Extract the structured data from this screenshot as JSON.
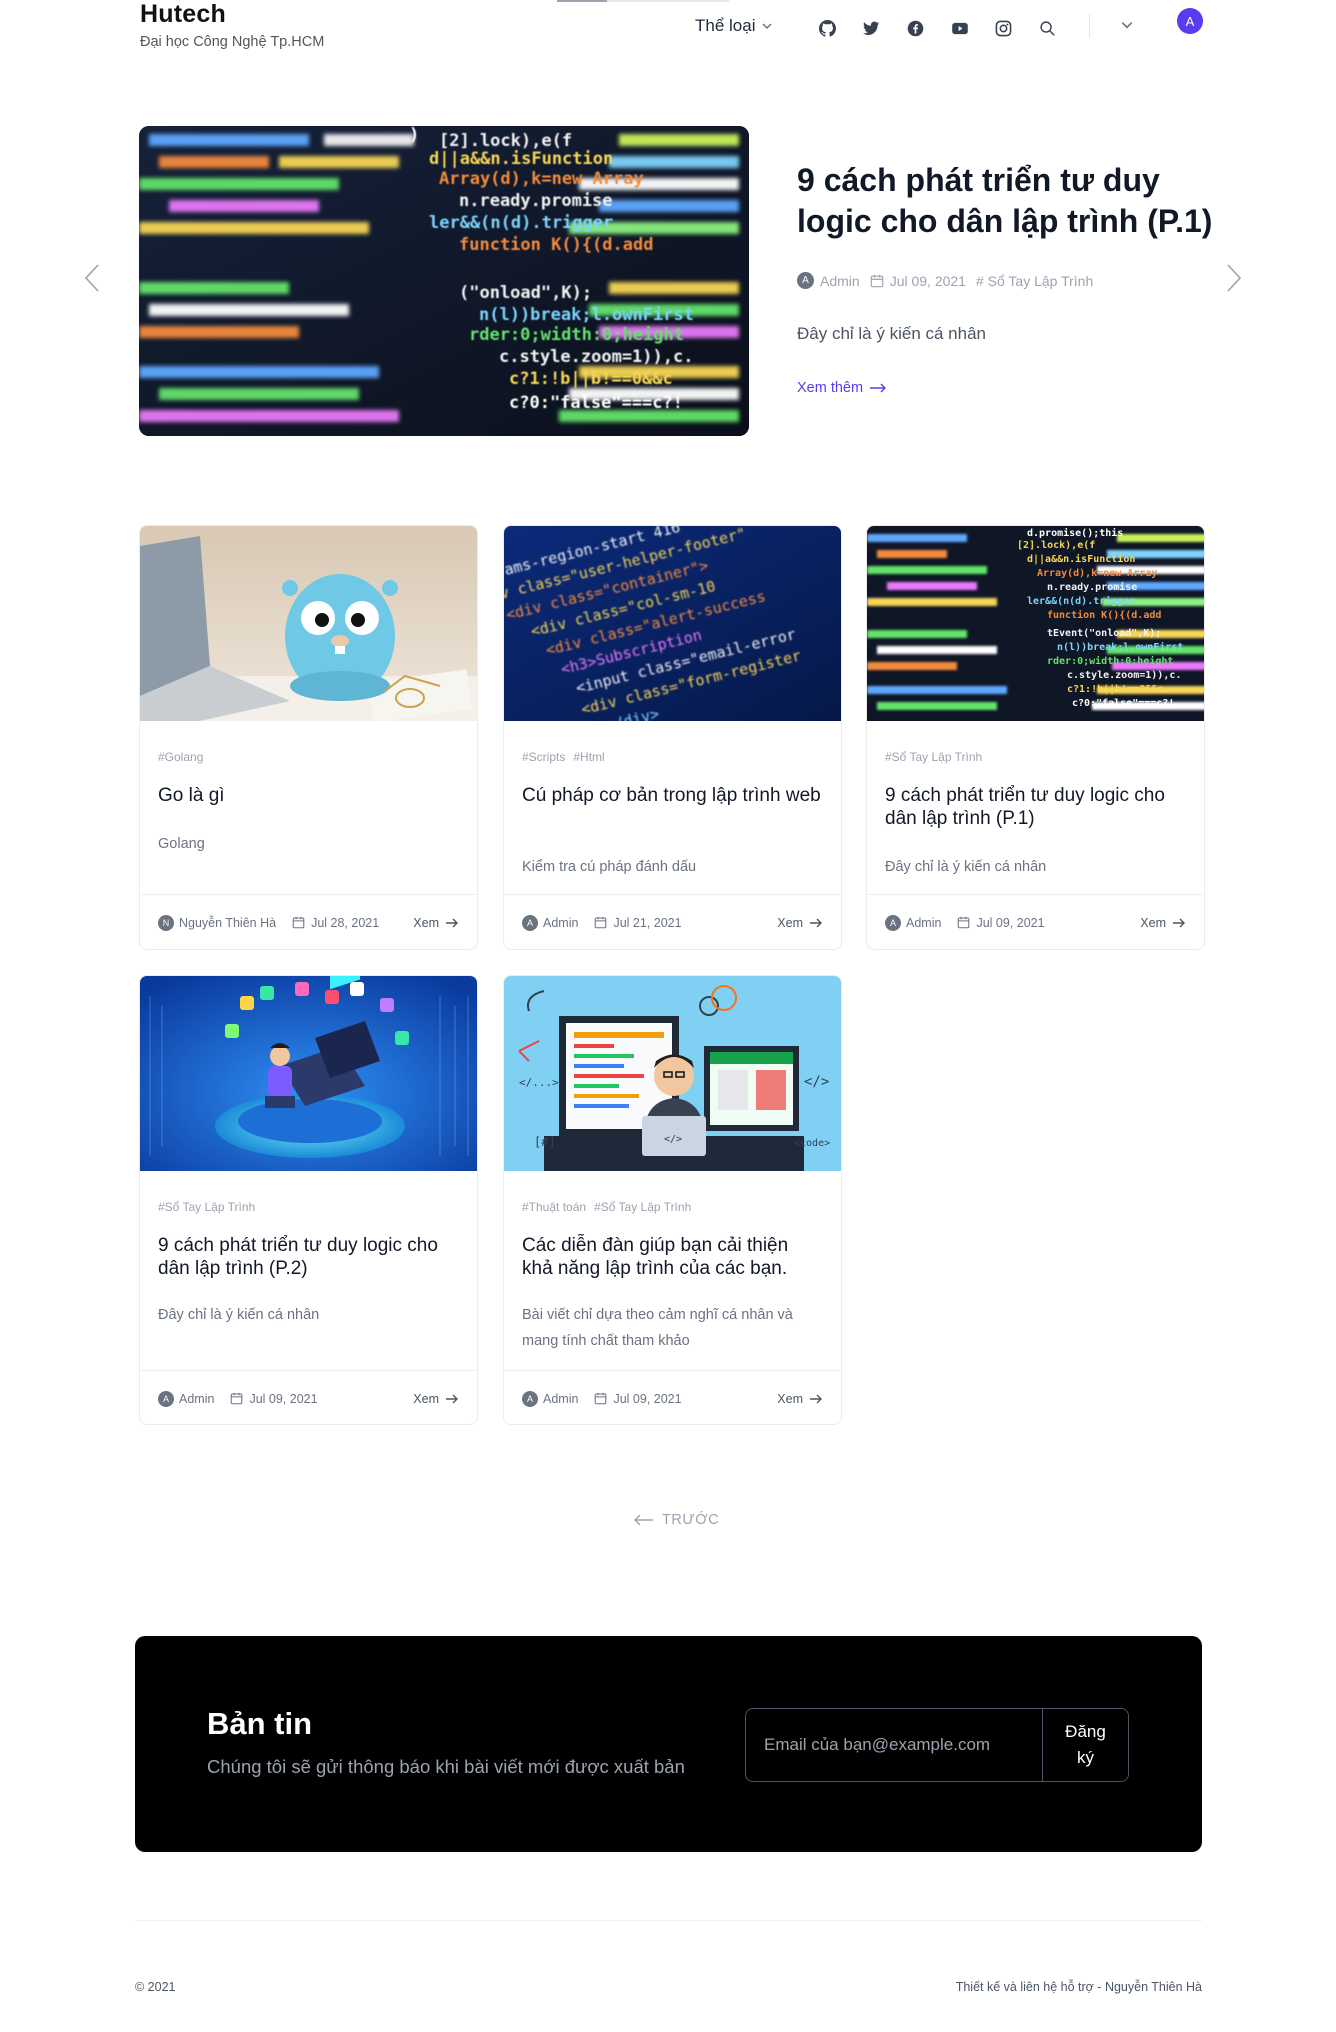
{
  "brand": {
    "title": "Hutech",
    "subtitle": "Đại học Công Nghệ Tp.HCM"
  },
  "nav": {
    "category_label": "Thể loại",
    "icons": [
      "github-icon",
      "twitter-icon",
      "facebook-icon",
      "youtube-icon",
      "instagram-icon",
      "search-icon"
    ],
    "avatar_letter": "A"
  },
  "hero": {
    "title": "9 cách phát triển tư duy logic cho dân lập trình (P.1)",
    "author_initial": "A",
    "author": "Admin",
    "date": "Jul 09, 2021",
    "tag": "# Sổ Tay Lập Trình",
    "description": "Đây chỉ là ý kiến cá nhân",
    "read_more": "Xem thêm"
  },
  "cards": [
    {
      "tags": [
        "#Golang"
      ],
      "title": "Go là gì",
      "description": "Golang",
      "author_initial": "N",
      "author": "Nguyễn Thiên Hà",
      "date": "Jul 28, 2021",
      "read": "Xem"
    },
    {
      "tags": [
        "#Scripts",
        "#Html"
      ],
      "title": "Cú pháp cơ bản trong lập trình web",
      "description": "Kiểm tra cú pháp đánh dấu",
      "author_initial": "A",
      "author": "Admin",
      "date": "Jul 21, 2021",
      "read": "Xem"
    },
    {
      "tags": [
        "#Sổ Tay Lập Trình"
      ],
      "title": "9 cách phát triển tư duy logic cho dân lập trình (P.1)",
      "description": "Đây chỉ là ý kiến cá nhân",
      "author_initial": "A",
      "author": "Admin",
      "date": "Jul 09, 2021",
      "read": "Xem"
    },
    {
      "tags": [
        "#Sổ Tay Lập Trình"
      ],
      "title": "9 cách phát triển tư duy logic cho dân lập trình (P.2)",
      "description": "Đây chỉ là ý kiến cá nhân",
      "author_initial": "A",
      "author": "Admin",
      "date": "Jul 09, 2021",
      "read": "Xem"
    },
    {
      "tags": [
        "#Thuật toán",
        "#Sổ Tay Lập Trình"
      ],
      "title": "Các diễn đàn giúp bạn cải thiện khả năng lập trình của các bạn.",
      "description": "Bài viết chỉ dựa theo cảm nghĩ cá nhân và mang tính chất tham khảo",
      "author_initial": "A",
      "author": "Admin",
      "date": "Jul 09, 2021",
      "read": "Xem"
    }
  ],
  "pagination": {
    "prev_label": "TRƯỚC"
  },
  "newsletter": {
    "title": "Bản tin",
    "subtitle": "Chúng tôi sẽ gửi thông báo khi bài viết mới được xuất bản",
    "email_placeholder": "Email của bạn@example.com",
    "email_value": "",
    "subscribe_label": "Đăng ký"
  },
  "footer": {
    "copyright": "© 2021",
    "credit": "Thiết kế và liên hệ hỗ trợ - Nguyễn Thiên Hà"
  },
  "colors": {
    "accent": "#5b3bf0",
    "newsletter_bg": "#000000"
  },
  "images": {
    "hero": "code-screen-image",
    "card_1": "golang-gopher-laptop-image",
    "card_2": "html-code-screen-image",
    "card_3": "code-screen-image",
    "card_4": "isometric-developer-image",
    "card_5": "web-developer-illustration-image"
  }
}
